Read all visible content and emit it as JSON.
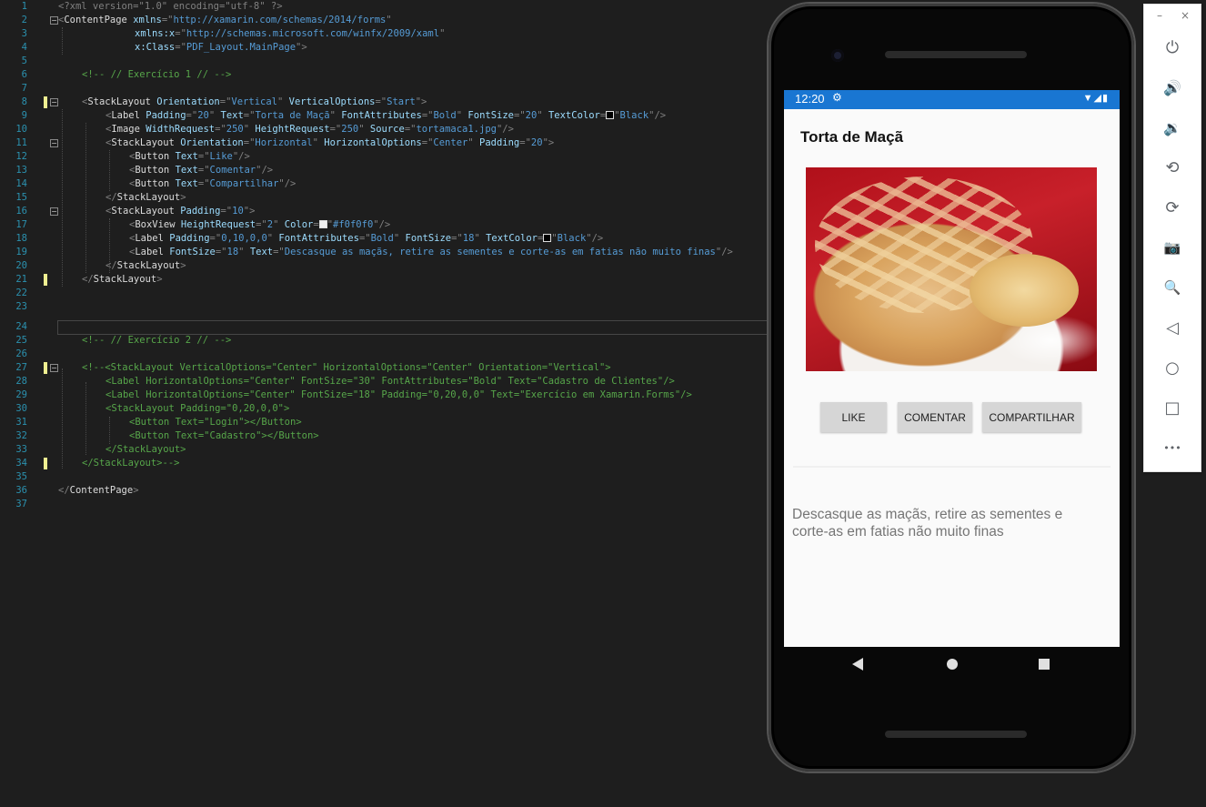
{
  "editor": {
    "lines": [
      {
        "n": "1"
      },
      {
        "n": "2"
      },
      {
        "n": "3"
      },
      {
        "n": "4"
      },
      {
        "n": "5"
      },
      {
        "n": "6"
      },
      {
        "n": "7"
      },
      {
        "n": "8"
      },
      {
        "n": "9"
      },
      {
        "n": "10"
      },
      {
        "n": "11"
      },
      {
        "n": "12"
      },
      {
        "n": "13"
      },
      {
        "n": "14"
      },
      {
        "n": "15"
      },
      {
        "n": "16"
      },
      {
        "n": "17"
      },
      {
        "n": "18"
      },
      {
        "n": "19"
      },
      {
        "n": "20"
      },
      {
        "n": "21"
      },
      {
        "n": "22"
      },
      {
        "n": "23"
      },
      {
        "n": "24"
      },
      {
        "n": "25"
      },
      {
        "n": "26"
      },
      {
        "n": "27"
      },
      {
        "n": "28"
      },
      {
        "n": "29"
      },
      {
        "n": "30"
      },
      {
        "n": "31"
      },
      {
        "n": "32"
      },
      {
        "n": "33"
      },
      {
        "n": "34"
      },
      {
        "n": "35"
      },
      {
        "n": "36"
      },
      {
        "n": "37"
      }
    ],
    "code": {
      "l1": "<?xml version=\"1.0\" encoding=\"utf-8\" ?>",
      "l2_tag": "ContentPage",
      "l2_attr": "xmlns",
      "l2_val": "http://xamarin.com/schemas/2014/forms",
      "l3_attr": "xmlns:x",
      "l3_val": "http://schemas.microsoft.com/winfx/2009/xaml",
      "l4_attr": "x:Class",
      "l4_val": "PDF_Layout.MainPage",
      "l6": "<!-- // Exercício 1 // -->",
      "l8_tag": "StackLayout",
      "l8_a1": "Orientation",
      "l8_v1": "Vertical",
      "l8_a2": "VerticalOptions",
      "l8_v2": "Start",
      "l9_tag": "Label",
      "l9_a1": "Padding",
      "l9_v1": "20",
      "l9_a2": "Text",
      "l9_v2": "Torta de Maçã",
      "l9_a3": "FontAttributes",
      "l9_v3": "Bold",
      "l9_a4": "FontSize",
      "l9_v4": "20",
      "l9_a5": "TextColor",
      "l9_v5": "Black",
      "l10_tag": "Image",
      "l10_a1": "WidthRequest",
      "l10_v1": "250",
      "l10_a2": "HeightRequest",
      "l10_v2": "250",
      "l10_a3": "Source",
      "l10_v3": "tortamaca1.jpg",
      "l11_tag": "StackLayout",
      "l11_a1": "Orientation",
      "l11_v1": "Horizontal",
      "l11_a2": "HorizontalOptions",
      "l11_v2": "Center",
      "l11_a3": "Padding",
      "l11_v3": "20",
      "l12_tag": "Button",
      "l12_a1": "Text",
      "l12_v1": "Like",
      "l13_tag": "Button",
      "l13_a1": "Text",
      "l13_v1": "Comentar",
      "l14_tag": "Button",
      "l14_a1": "Text",
      "l14_v1": "Compartilhar",
      "l15_tag": "StackLayout",
      "l16_tag": "StackLayout",
      "l16_a1": "Padding",
      "l16_v1": "10",
      "l17_tag": "BoxView",
      "l17_a1": "HeightRequest",
      "l17_v1": "2",
      "l17_a2": "Color",
      "l17_v2": "#f0f0f0",
      "l18_tag": "Label",
      "l18_a1": "Padding",
      "l18_v1": "0,10,0,0",
      "l18_a2": "FontAttributes",
      "l18_v2": "Bold",
      "l18_a3": "FontSize",
      "l18_v3": "18",
      "l18_a4": "TextColor",
      "l18_v4": "Black",
      "l19_tag": "Label",
      "l19_a1": "FontSize",
      "l19_v1": "18",
      "l19_a2": "Text",
      "l19_v2": "Descasque as maçãs, retire as sementes e corte-as em fatias não muito finas",
      "l20_tag": "StackLayout",
      "l21_tag": "StackLayout",
      "l25": "<!-- // Exercício 2 // -->",
      "l27": "<!--<StackLayout VerticalOptions=\"Center\" HorizontalOptions=\"Center\" Orientation=\"Vertical\">",
      "l28": "<Label HorizontalOptions=\"Center\" FontSize=\"30\" FontAttributes=\"Bold\" Text=\"Cadastro de Clientes\"/>",
      "l29": "<Label HorizontalOptions=\"Center\" FontSize=\"18\" Padding=\"0,20,0,0\" Text=\"Exercício em Xamarin.Forms\"/>",
      "l30": "<StackLayout Padding=\"0,20,0,0\">",
      "l31": "<Button Text=\"Login\"></Button>",
      "l32": "<Button Text=\"Cadastro\"></Button>",
      "l33": "</StackLayout>",
      "l34": "</StackLayout>-->",
      "l36_tag": "ContentPage"
    }
  },
  "phone": {
    "status_time": "12:20",
    "title": "Torta de Maçã",
    "buttons": {
      "like": "LIKE",
      "comentar": "COMENTAR",
      "compartilhar": "COMPARTILHAR"
    },
    "description": "Descasque as maçãs, retire as sementes e corte-as em fatias não muito finas",
    "status_bar_color": "#1976d2",
    "divider_color": "#f0f0f0"
  },
  "toolbar": {
    "minimize": "–",
    "close": "×",
    "items": [
      {
        "icon": "power-icon",
        "glyph": "⏻"
      },
      {
        "icon": "volume-up-icon",
        "glyph": "🔊"
      },
      {
        "icon": "volume-down-icon",
        "glyph": "🔉"
      },
      {
        "icon": "rotate-left-icon",
        "glyph": "⟲"
      },
      {
        "icon": "rotate-right-icon",
        "glyph": "⟳"
      },
      {
        "icon": "camera-icon",
        "glyph": "📷"
      },
      {
        "icon": "zoom-icon",
        "glyph": "🔍"
      },
      {
        "icon": "back-icon",
        "glyph": "◁"
      },
      {
        "icon": "home-icon",
        "glyph": "○"
      },
      {
        "icon": "overview-icon",
        "glyph": "□"
      },
      {
        "icon": "more-icon",
        "glyph": "•••"
      }
    ]
  }
}
